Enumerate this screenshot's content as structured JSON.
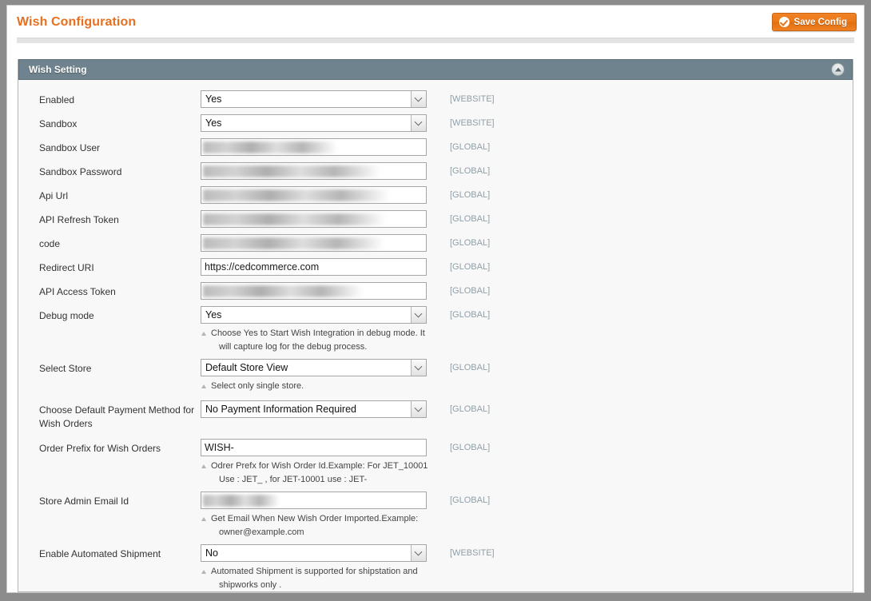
{
  "header": {
    "title": "Wish Configuration",
    "save_label": "Save Config",
    "save_icon": "check-circle-icon"
  },
  "section": {
    "title": "Wish Setting",
    "collapse_icon": "triangle-up-icon"
  },
  "scopes": {
    "website": "[WEBSITE]",
    "global": "[GLOBAL]"
  },
  "fields": [
    {
      "label": "Enabled",
      "type": "select",
      "value": "Yes",
      "scope": "[WEBSITE]"
    },
    {
      "label": "Sandbox",
      "type": "select",
      "value": "Yes",
      "scope": "[WEBSITE]"
    },
    {
      "label": "Sandbox User",
      "type": "redacted",
      "value": "",
      "scope": "[GLOBAL]"
    },
    {
      "label": "Sandbox Password",
      "type": "redacted",
      "value": "",
      "scope": "[GLOBAL]"
    },
    {
      "label": "Api Url",
      "type": "redacted",
      "value": "",
      "scope": "[GLOBAL]"
    },
    {
      "label": "API Refresh Token",
      "type": "redacted",
      "value": "",
      "scope": "[GLOBAL]"
    },
    {
      "label": "code",
      "type": "redacted",
      "value": "",
      "scope": "[GLOBAL]"
    },
    {
      "label": "Redirect URI",
      "type": "text",
      "value": "https://cedcommerce.com",
      "scope": "[GLOBAL]"
    },
    {
      "label": "API Access Token",
      "type": "redacted",
      "value": "",
      "scope": "[GLOBAL]"
    },
    {
      "label": "Debug mode",
      "type": "select",
      "value": "Yes",
      "scope": "[GLOBAL]",
      "hint1": "Choose Yes to Start Wish Integration in debug mode. It",
      "hint2": "will capture log for the debug process."
    },
    {
      "label": "Select Store",
      "type": "select",
      "value": "Default Store View",
      "scope": "[GLOBAL]",
      "hint1": "Select only single store.",
      "hint2": ""
    },
    {
      "label": "Choose Default Payment Method for Wish Orders",
      "type": "select",
      "value": "No Payment Information Required",
      "scope": "[GLOBAL]"
    },
    {
      "label": "Order Prefix for Wish Orders",
      "type": "text",
      "value": "WISH-",
      "scope": "[GLOBAL]",
      "hint1": "Odrer Prefx for Wish Order Id.Example: For JET_10001",
      "hint2": "Use : JET_ , for JET-10001 use : JET-"
    },
    {
      "label": "Store Admin Email Id",
      "type": "redacted",
      "value": "",
      "scope": "[GLOBAL]",
      "hint1": "Get Email When New Wish Order Imported.Example:",
      "hint2": "owner@example.com"
    },
    {
      "label": "Enable Automated Shipment",
      "type": "select",
      "value": "No",
      "scope": "[WEBSITE]",
      "hint1": "Automated Shipment is supported for shipstation and",
      "hint2": "shipworks only ."
    }
  ],
  "colors": {
    "title": "#e76f20",
    "section_header": "#6e838d",
    "save_button": "#ea7818",
    "scope_text": "#8f9fa8",
    "form_bg": "#f8f8f8"
  }
}
